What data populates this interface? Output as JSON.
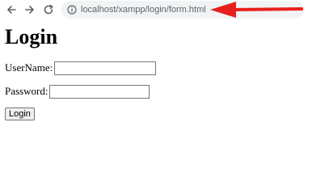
{
  "browser": {
    "url": "localhost/xampp/login/form.html",
    "back_icon": "arrow-left-icon",
    "forward_icon": "arrow-right-icon",
    "reload_icon": "reload-icon",
    "site_info_icon": "info-icon",
    "annotation_color": "#e8201c"
  },
  "page": {
    "heading": "Login",
    "username_label": "UserName:",
    "username_value": "",
    "password_label": "Password:",
    "password_value": "",
    "submit_label": "Login"
  }
}
